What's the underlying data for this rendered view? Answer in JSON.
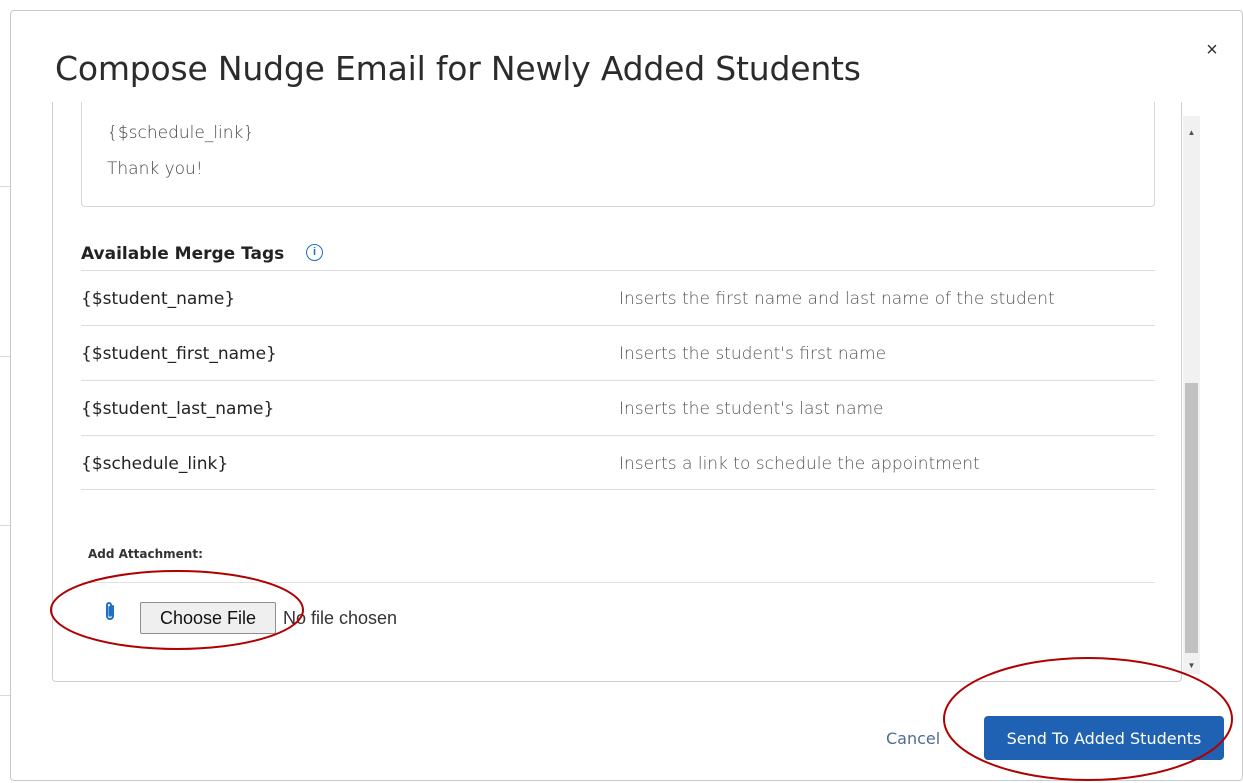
{
  "dialog": {
    "title": "Compose Nudge Email for Newly Added Students",
    "close_icon": "×"
  },
  "message": {
    "lines": [
      "{$schedule_link}",
      "Thank you!"
    ]
  },
  "merge_tags": {
    "heading": "Available Merge Tags",
    "info_icon": "i",
    "rows": [
      {
        "tag": "{$student_name}",
        "description": "Inserts the first name and last name of the student"
      },
      {
        "tag": "{$student_first_name}",
        "description": "Inserts the student's first name"
      },
      {
        "tag": "{$student_last_name}",
        "description": "Inserts the student's last name"
      },
      {
        "tag": "{$schedule_link}",
        "description": "Inserts a link to schedule the appointment"
      }
    ]
  },
  "attachment": {
    "label": "Add Attachment:",
    "icon": "paperclip-icon",
    "choose_file_label": "Choose File",
    "file_status": "No file chosen"
  },
  "scrollbar": {
    "up_icon": "▲",
    "down_icon": "▼"
  },
  "footer": {
    "cancel_label": "Cancel",
    "send_label": "Send To Added Students"
  },
  "colors": {
    "primary_button": "#1f62b4",
    "info_icon": "#1f6fc5",
    "annotation": "#b00000"
  }
}
